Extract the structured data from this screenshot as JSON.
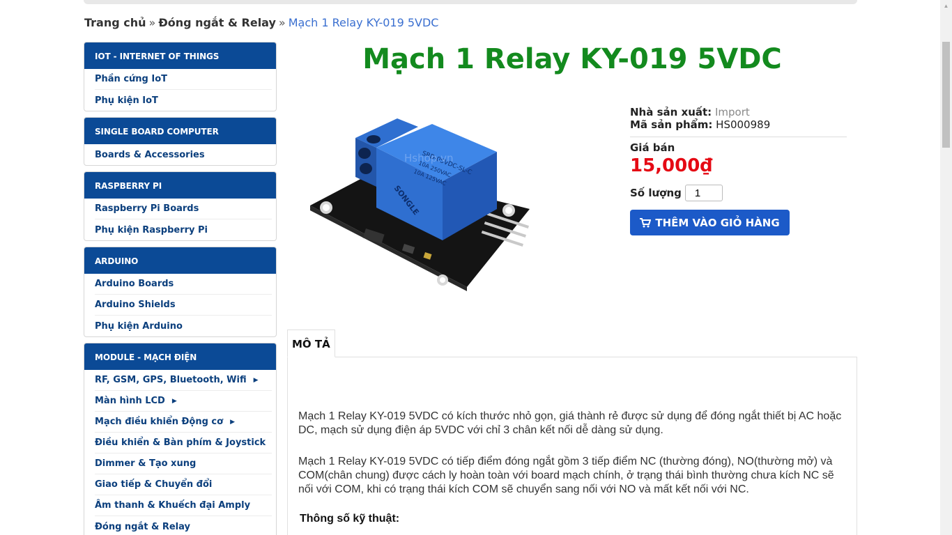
{
  "breadcrumb": {
    "home": "Trang chủ",
    "sep": "»",
    "category": "Đóng ngắt & Relay",
    "current": "Mạch 1 Relay KY-019 5VDC"
  },
  "sidebar": {
    "groups": [
      {
        "title": "IOT - INTERNET OF THINGS",
        "items": [
          "Phần cứng IoT",
          "Phụ kiện IoT"
        ]
      },
      {
        "title": "SINGLE BOARD COMPUTER",
        "items": [
          "Boards & Accessories"
        ]
      },
      {
        "title": "RASPBERRY PI",
        "items": [
          "Raspberry Pi Boards",
          "Phụ kiện Raspberry Pi"
        ]
      },
      {
        "title": "ARDUINO",
        "items": [
          "Arduino Boards",
          "Arduino Shields",
          "Phụ kiện Arduino"
        ]
      },
      {
        "title": "MODULE - MẠCH ĐIỆN",
        "items": [
          "RF, GSM, GPS, Bluetooth, Wifi",
          "Màn hình LCD",
          "Mạch điều khiển Động cơ",
          "Điều khiển & Bàn phím & Joystick",
          "Dimmer & Tạo xung",
          "Giao tiếp & Chuyển đổi",
          "Âm thanh & Khuếch đại Amply",
          "Đóng ngắt & Relay"
        ]
      }
    ],
    "caret_items": [
      "RF, GSM, GPS, Bluetooth, Wifi",
      "Màn hình LCD",
      "Mạch điều khiển Động cơ"
    ]
  },
  "product": {
    "title": "Mạch 1 Relay KY-019 5VDC",
    "manufacturer_label": "Nhà sản xuất:",
    "manufacturer": "Import",
    "sku_label": "Mã sản phẩm:",
    "sku": "HS000989",
    "price_label": "Giá bán",
    "price": "15,000₫",
    "qty_label": "Số lượng",
    "qty": "1",
    "cart_button": "THÊM VÀO GIỎ HÀNG",
    "image_watermark": "Hshop.vn",
    "relay_text_1": "SRD-05VDC-SL-C",
    "relay_text_2": "10A 250VAC",
    "relay_text_3": "10A 125VAC",
    "relay_text_4": "SONGLE"
  },
  "tabs": {
    "description_tab": "MÔ TẢ",
    "paragraph_1": "Mạch 1 Relay KY-019 5VDC có kích thước nhỏ gọn, giá thành rẻ được sử dụng để đóng ngắt thiết bị AC hoặc DC, mạch sử dụng điện áp 5VDC với chỉ 3 chân kết nối dễ dàng sử dụng.",
    "paragraph_2": "Mạch 1 Relay KY-019 5VDC có tiếp điểm đóng ngắt gồm 3 tiếp điểm NC (thường đóng), NO(thường mở) và COM(chân chung) được cách ly hoàn toàn với board mạch chính, ở trạng thái bình thường chưa kích NC sẽ nối với COM, khi có trạng thái kích COM sẽ chuyển sang nối với NO và mất kết nối với NC.",
    "specs_heading": "Thông số kỹ thuật:"
  },
  "colors": {
    "sidebar_header": "#0b4a96",
    "title_green": "#138a1e",
    "price_red": "#e50914",
    "button_blue": "#1c5ac8"
  }
}
